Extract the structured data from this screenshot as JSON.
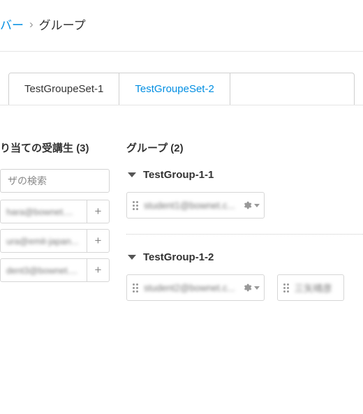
{
  "breadcrumb": {
    "parent": "バー",
    "separator": "›",
    "current": "グループ"
  },
  "tabs": [
    {
      "label": "TestGroupeSet-1",
      "active": true
    },
    {
      "label": "TestGroupeSet-2",
      "active": false
    }
  ],
  "left": {
    "title_prefix": "り当ての受講生",
    "count_label": "(3)",
    "search_placeholder": "ザの検索",
    "students": [
      {
        "name": "hara@bownet...."
      },
      {
        "name": "ura@emit-japan..."
      },
      {
        "name": "dent3@bownet...."
      }
    ]
  },
  "right": {
    "title_prefix": "グループ",
    "count_label": "(2)",
    "groups": [
      {
        "name": "TestGroup-1-1",
        "members": [
          {
            "name": "student1@bownet.c...",
            "has_gear": true
          }
        ]
      },
      {
        "name": "TestGroup-1-2",
        "members": [
          {
            "name": "student2@bownet.c...",
            "has_gear": true
          },
          {
            "name": "三矢晴彦",
            "has_gear": false
          }
        ]
      }
    ]
  }
}
